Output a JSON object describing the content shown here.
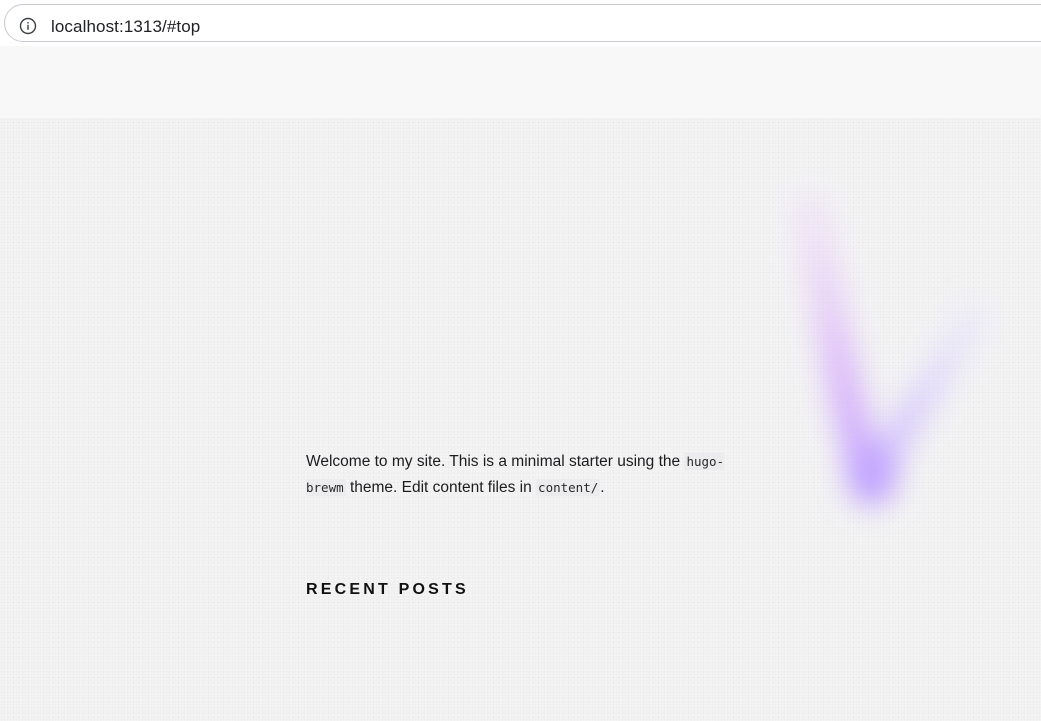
{
  "browser": {
    "url": "localhost:1313/#top",
    "info_icon": "info-icon"
  },
  "intro": {
    "text_before": "Welcome to my site. This is a minimal starter using the ",
    "theme_code": "hugo-brewm",
    "text_middle": " theme. Edit content files in ",
    "content_code": "content/",
    "text_after": "."
  },
  "recent_posts": {
    "heading": "RECENT POSTS"
  },
  "colors": {
    "glow_violet": "#c9a8ff",
    "glow_pink": "#e7c4fb",
    "glow_lavender": "#cfc6ff"
  }
}
